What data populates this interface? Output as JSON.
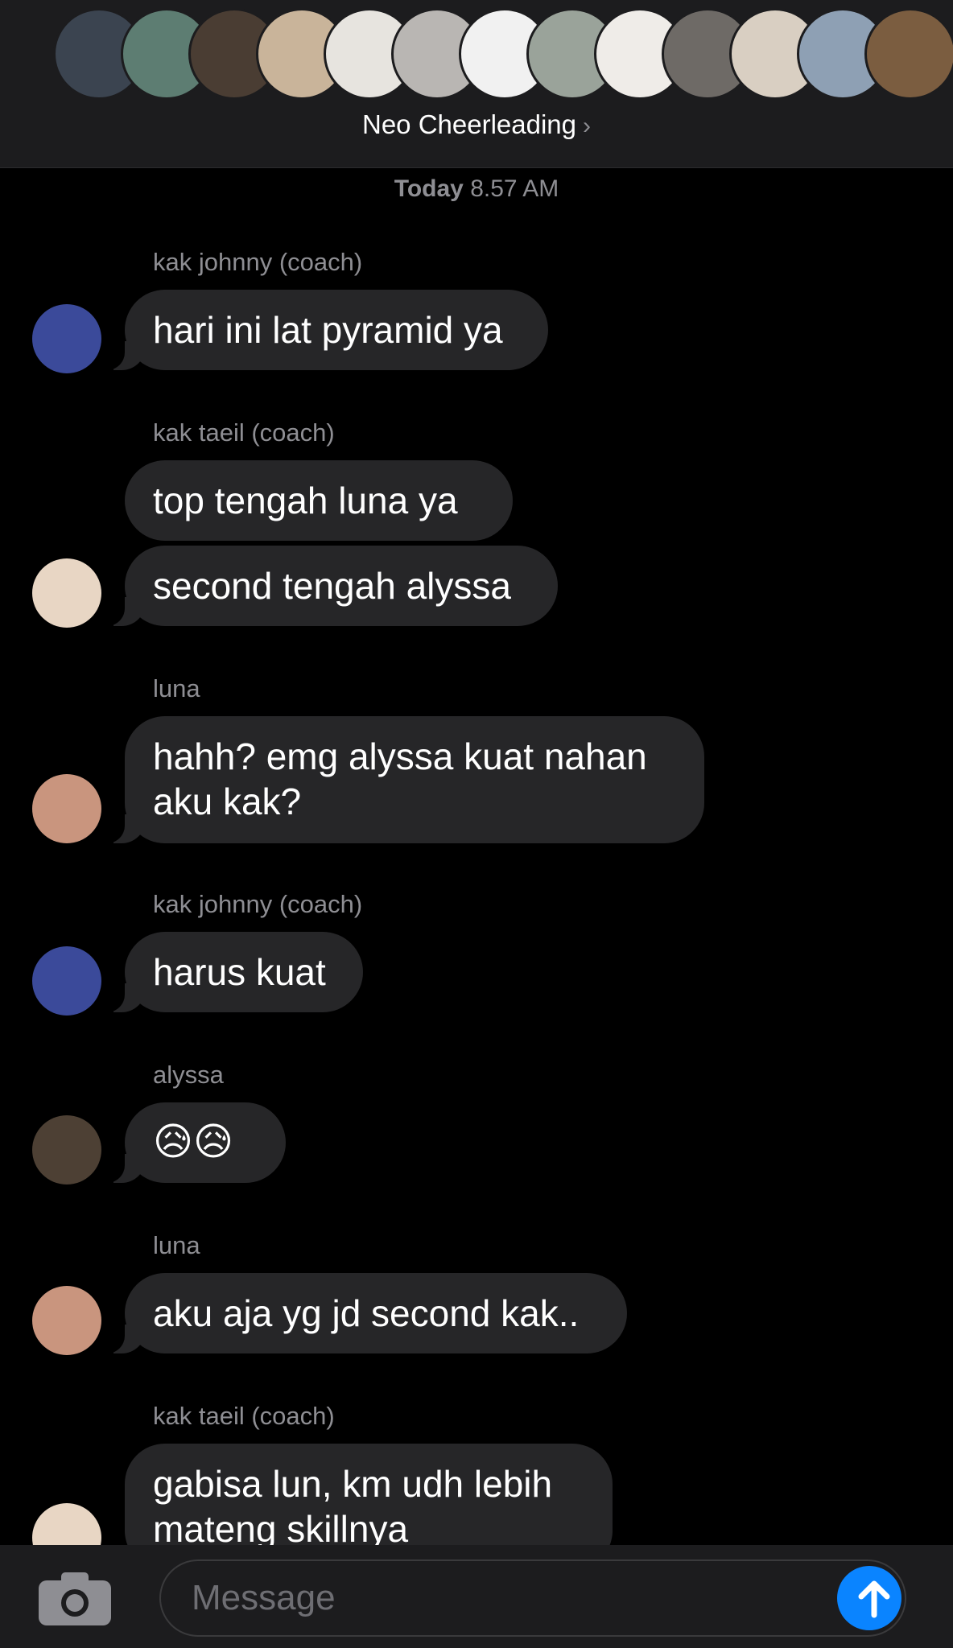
{
  "header": {
    "group_name": "Neo Cheerleading",
    "chevron": "›",
    "member_avatars": [
      {
        "icon": "group-photo-avatar",
        "color": "#3b4450"
      },
      {
        "icon": "member-avatar",
        "color": "#5d7d72"
      },
      {
        "icon": "member-avatar",
        "color": "#4a3d33"
      },
      {
        "icon": "member-avatar",
        "color": "#c9b49a"
      },
      {
        "icon": "member-avatar",
        "color": "#e7e4df"
      },
      {
        "icon": "member-avatar",
        "color": "#b9b6b3"
      },
      {
        "icon": "member-avatar",
        "color": "#f1f1f1"
      },
      {
        "icon": "member-avatar",
        "color": "#9aa39a"
      },
      {
        "icon": "member-avatar",
        "color": "#efece8"
      },
      {
        "icon": "member-avatar",
        "color": "#6e6a66"
      },
      {
        "icon": "member-avatar",
        "color": "#d9cfc2"
      },
      {
        "icon": "member-avatar",
        "color": "#8ea0b4"
      },
      {
        "icon": "member-avatar",
        "color": "#7b5d40"
      }
    ]
  },
  "timestamp": {
    "day": "Today",
    "time": "8.57 AM"
  },
  "messages": [
    {
      "sender": "kak johnny (coach)",
      "bubbles": [
        "hari ini lat pyramid ya"
      ]
    },
    {
      "sender": "kak taeil (coach)",
      "bubbles": [
        "top tengah luna ya",
        "second tengah alyssa"
      ]
    },
    {
      "sender": "luna",
      "bubbles": [
        "hahh? emg alyssa kuat nahan\naku kak?"
      ]
    },
    {
      "sender": "kak johnny (coach)",
      "bubbles": [
        "harus kuat"
      ]
    },
    {
      "sender": "alyssa",
      "bubbles": [
        "😥😥"
      ]
    },
    {
      "sender": "luna",
      "bubbles": [
        "aku aja yg jd second kak.."
      ]
    },
    {
      "sender": "kak taeil (coach)",
      "bubbles": [
        "gabisa lun, km udh lebih\nmateng skillnya"
      ]
    }
  ],
  "avatar_colors": {
    "kak johnny (coach)": "#3b4a9a",
    "kak taeil (coach)": "#e8d6c4",
    "luna": "#c9957e",
    "alyssa": "#4d4034"
  },
  "composer": {
    "placeholder": "Message",
    "camera_icon": "camera-icon",
    "send_icon": "arrow-up-icon",
    "send_color": "#0a84ff"
  }
}
